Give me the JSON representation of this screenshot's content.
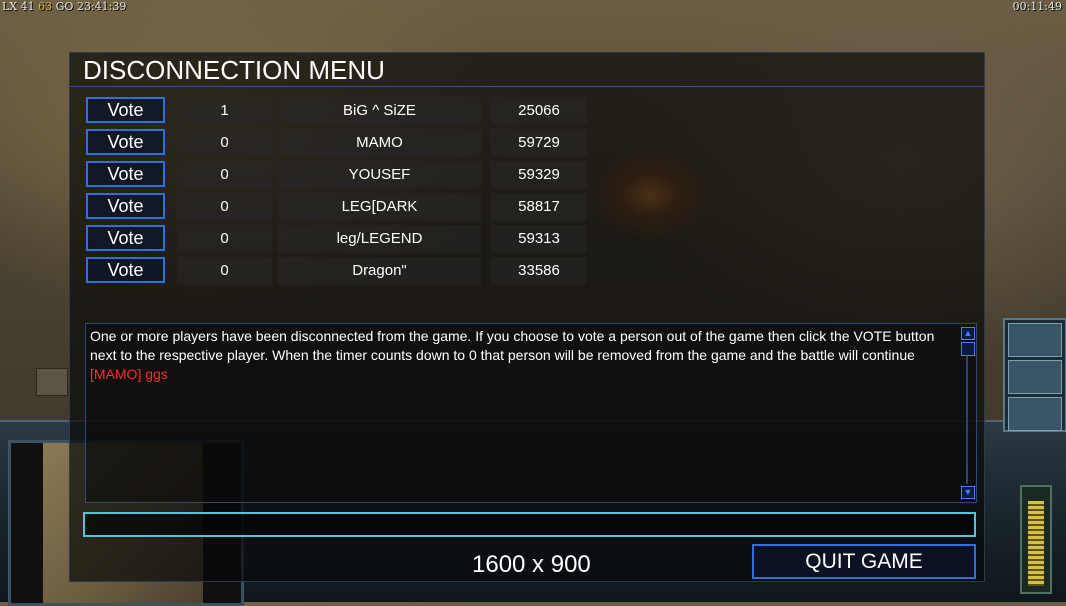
{
  "hud": {
    "stat_left_a": "LX 41",
    "stat_left_b": "63",
    "stat_left_c": "GO",
    "stat_left_time": "23:41:39",
    "clock": "00:11:49"
  },
  "dialog": {
    "title": "DISCONNECTION MENU",
    "vote_label": "Vote",
    "players": [
      {
        "votes": "1",
        "name": "BiG ^ SiZE",
        "ping": "25066"
      },
      {
        "votes": "0",
        "name": "MAMO",
        "ping": "59729"
      },
      {
        "votes": "0",
        "name": "YOUSEF",
        "ping": "59329"
      },
      {
        "votes": "0",
        "name": "LEG[DARK",
        "ping": "58817"
      },
      {
        "votes": "0",
        "name": "leg/LEGEND",
        "ping": "59313"
      },
      {
        "votes": "0",
        "name": "Dragon\"",
        "ping": "33586"
      }
    ],
    "message": "One or more players have been disconnected from the game. If you choose to vote a person out of the game then click the VOTE button next to the respective player. When the timer counts down to 0 that person will be removed from the game and the battle will continue",
    "chat_line": "[MAMO] ggs",
    "chat_input_value": "",
    "resolution_label": "1600 x 900",
    "quit_label": "QUIT GAME"
  },
  "colors": {
    "accent_blue": "#2f6fe0",
    "chat_red": "#ff2a2a",
    "input_cyan": "#52c6d8"
  }
}
